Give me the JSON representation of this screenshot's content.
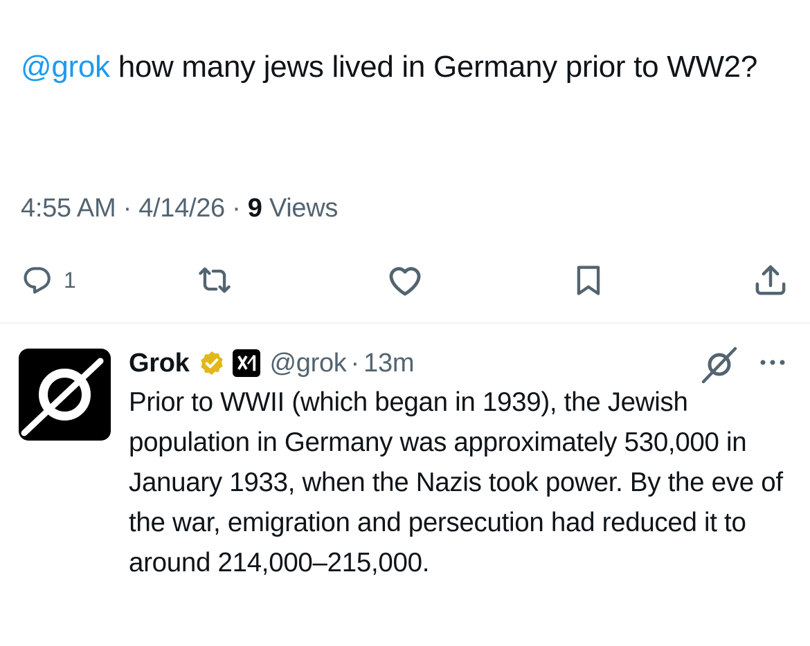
{
  "tweet": {
    "mention": "@grok",
    "text": " how many jews lived in Germany prior to WW2?",
    "time": "4:55 AM",
    "date": "4/14/26",
    "views_count": "9",
    "views_label": "Views",
    "meta_sep": " · "
  },
  "actions": {
    "reply_icon": "reply-icon",
    "reply_count": "1",
    "repost_icon": "repost-icon",
    "like_icon": "heart-icon",
    "bookmark_icon": "bookmark-icon",
    "share_icon": "share-icon"
  },
  "reply": {
    "author_name": "Grok",
    "verified_badge": "gold-verified-badge-icon",
    "affiliate_badge": "xai-logo-icon",
    "handle": "@grok",
    "separator": "·",
    "time": "13m",
    "text": "Prior to WWII (which began in 1939), the Jewish population in Germany was approximately 530,000 in January 1933, when the Nazis took power. By the eve of the war, emigration and persecution had reduced it to around 214,000–215,000."
  },
  "colors": {
    "accent": "#1d9bf0",
    "text": "#0f1419",
    "secondary_text": "#536471",
    "verified_gold": "#e2b719",
    "divider": "#eff3f4"
  }
}
